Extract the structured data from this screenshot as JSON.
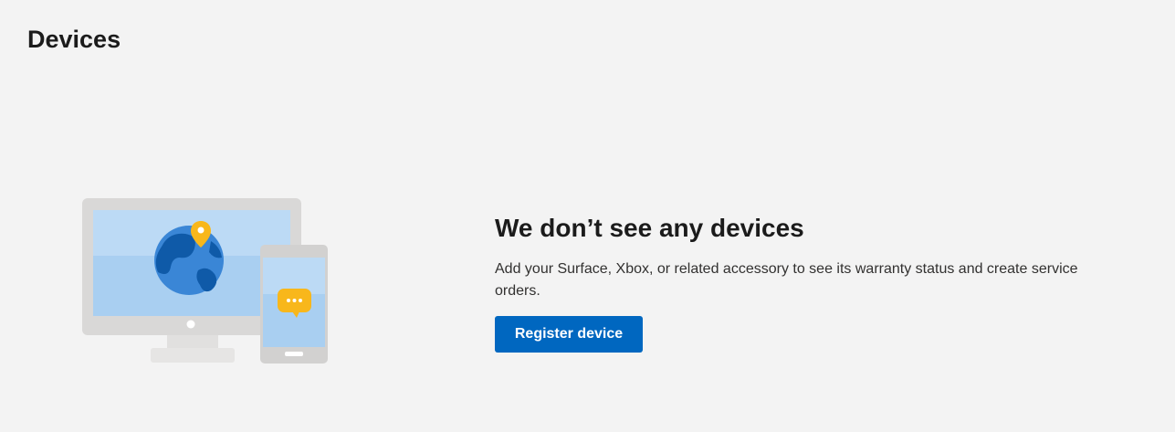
{
  "page": {
    "title": "Devices"
  },
  "empty_state": {
    "heading": "We don’t see any devices",
    "description": "Add your Surface, Xbox, or related accessory to see its warranty status and create service orders.",
    "button_label": "Register device"
  },
  "illustration": {
    "icons": [
      "monitor-icon",
      "globe-icon",
      "location-pin-icon",
      "phone-icon",
      "chat-bubble-icon"
    ]
  },
  "colors": {
    "background": "#f3f3f3",
    "accent": "#0067c0",
    "pin": "#f8b71b"
  }
}
